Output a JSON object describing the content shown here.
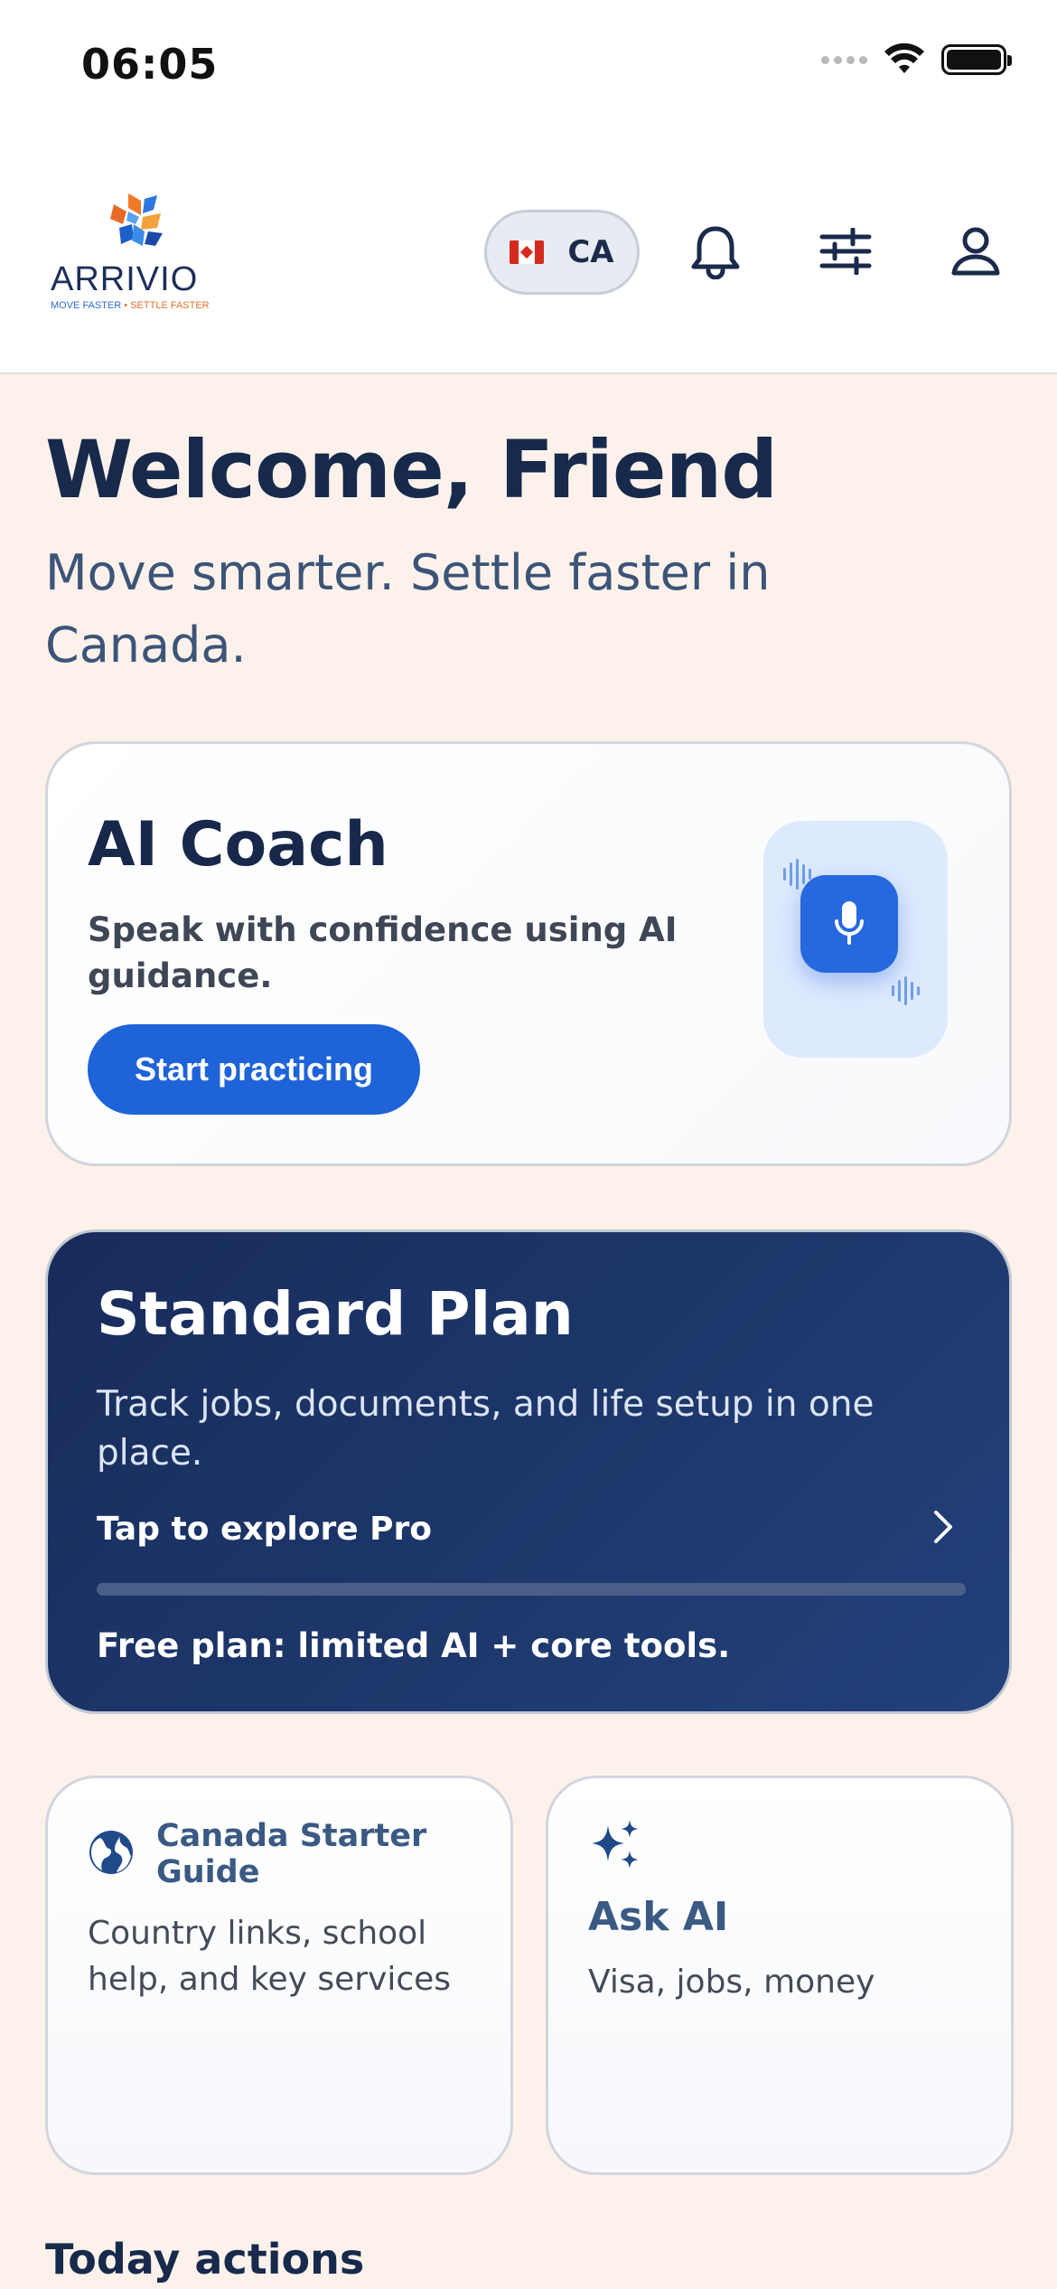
{
  "status_bar": {
    "time": "06:05"
  },
  "header": {
    "logo": {
      "wordmark": "ARRIVIO",
      "tagline_part1": "MOVE FASTER",
      "tagline_sep": " • ",
      "tagline_part2": "SETTLE FASTER"
    },
    "country": {
      "code": "CA",
      "flag": "canada-flag"
    },
    "icons": [
      "bell-icon",
      "sliders-icon",
      "user-icon"
    ]
  },
  "welcome": {
    "title": "Welcome, Friend",
    "subtitle": "Move smarter. Settle faster in Canada."
  },
  "ai_coach": {
    "title": "AI Coach",
    "description": "Speak with confidence using AI guidance.",
    "button_label": "Start practicing",
    "icon": "microphone-icon"
  },
  "plan": {
    "title": "Standard Plan",
    "description": "Track jobs, documents, and life setup in one place.",
    "link_label": "Tap to explore Pro",
    "progress": 0,
    "note": "Free plan: limited AI + core tools."
  },
  "tiles": [
    {
      "title": "Canada Starter Guide",
      "description": "Country links, school help, and key services",
      "icon": "globe-icon"
    },
    {
      "title": "Ask AI",
      "description": "Visa, jobs, money",
      "icon": "sparkles-icon"
    }
  ],
  "sections": {
    "today_actions": "Today actions"
  },
  "colors": {
    "background": "#fdf2eb",
    "primary_blue": "#1e63d7",
    "navy": "#172a4c",
    "plan_card": "#1c3468",
    "logo_orange": "#e56f2b"
  }
}
